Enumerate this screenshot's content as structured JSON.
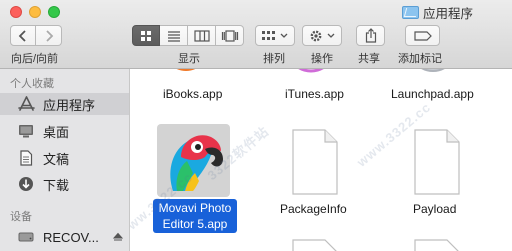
{
  "window": {
    "title": "应用程序"
  },
  "toolbar": {
    "nav_label": "向后/向前",
    "view_label": "显示",
    "arrange_label": "排列",
    "action_label": "操作",
    "share_label": "共享",
    "tags_label": "添加标记"
  },
  "sidebar": {
    "favorites_heading": "个人收藏",
    "favorites": [
      {
        "label": "应用程序",
        "icon": "applications-icon",
        "selected": true
      },
      {
        "label": "桌面",
        "icon": "desktop-icon",
        "selected": false
      },
      {
        "label": "文稿",
        "icon": "documents-icon",
        "selected": false
      },
      {
        "label": "下载",
        "icon": "downloads-icon",
        "selected": false
      }
    ],
    "devices_heading": "设备",
    "devices": [
      {
        "label": "RECOV...",
        "icon": "disk-icon"
      }
    ]
  },
  "files": {
    "top_row": [
      "iBooks.app",
      "iTunes.app",
      "Launchpad.app"
    ],
    "selected": {
      "line1": "Movavi Photo",
      "line2": "Editor 5.app"
    },
    "items": [
      "PackageInfo",
      "Payload"
    ]
  },
  "watermark": {
    "text": "3322软件站",
    "text2": "www.3322.cc"
  },
  "colors": {
    "selection": "#1861d9",
    "sidebar_bg": "#e4e4e6",
    "toolbar_top": "#ececec"
  }
}
